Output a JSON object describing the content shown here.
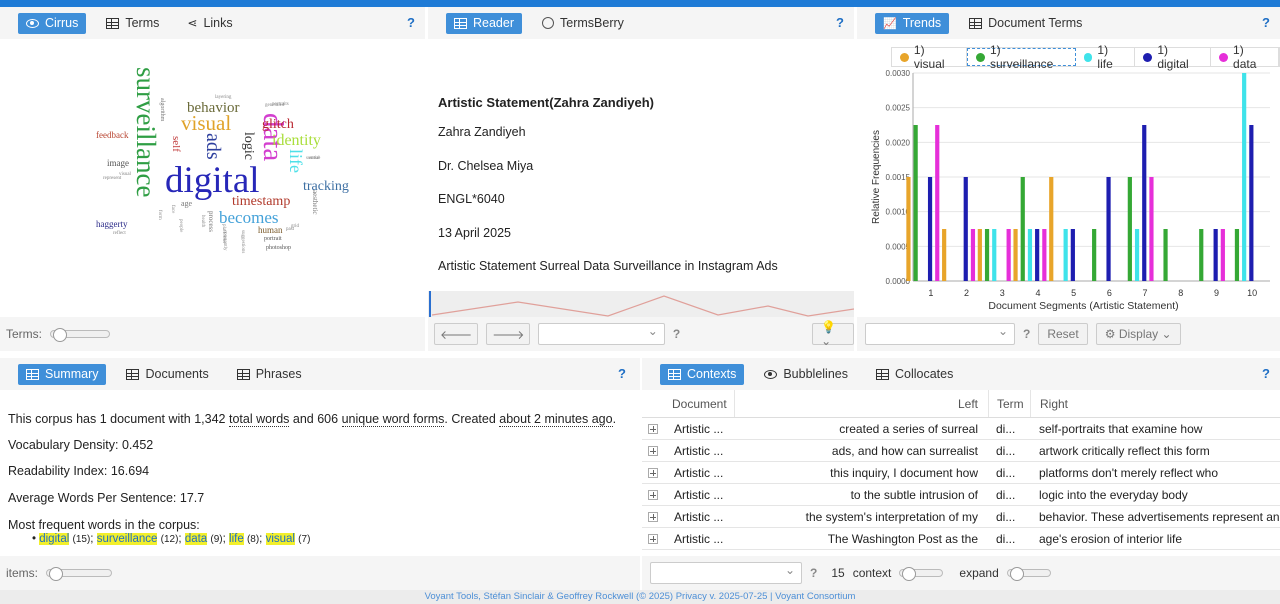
{
  "cirrus": {
    "tabs": [
      "Cirrus",
      "Terms",
      "Links"
    ],
    "help": "?",
    "footer_label": "Terms:",
    "words": [
      {
        "t": "surveillance",
        "size": 27,
        "color": "#2f9e44",
        "rot": 90
      },
      {
        "t": "digital",
        "size": 37,
        "color": "#2727b8",
        "rot": 0
      },
      {
        "t": "data",
        "size": 29,
        "color": "#d33fcf",
        "rot": 90
      },
      {
        "t": "visual",
        "size": 21,
        "color": "#e0a32a",
        "rot": 0
      },
      {
        "t": "ads",
        "size": 20,
        "color": "#2d3f9e",
        "rot": 90
      },
      {
        "t": "life",
        "size": 18,
        "color": "#4fe0e8",
        "rot": 90
      },
      {
        "t": "behavior",
        "size": 15,
        "color": "#6b6b3a",
        "rot": 0
      },
      {
        "t": "glitch",
        "size": 14,
        "color": "#b8252f",
        "rot": 0
      },
      {
        "t": "identity",
        "size": 16,
        "color": "#a9de3a",
        "rot": 0
      },
      {
        "t": "logic",
        "size": 14,
        "color": "#333",
        "rot": 90
      },
      {
        "t": "tracking",
        "size": 14,
        "color": "#3d6fa3",
        "rot": 0
      },
      {
        "t": "timestamp",
        "size": 14,
        "color": "#b13a2c",
        "rot": 0
      },
      {
        "t": "becomes",
        "size": 17,
        "color": "#45a2d9",
        "rot": 0
      },
      {
        "t": "self",
        "size": 11,
        "color": "#c03a3a",
        "rot": 90
      },
      {
        "t": "feedback",
        "size": 9,
        "color": "#b8432f",
        "rot": 0
      },
      {
        "t": "image",
        "size": 9,
        "color": "#555",
        "rot": 0
      },
      {
        "t": "haggerty",
        "size": 9,
        "color": "#2d2d8a",
        "rot": 0
      },
      {
        "t": "human",
        "size": 9,
        "color": "#7a5a2a",
        "rot": 0
      },
      {
        "t": "photoshop",
        "size": 6,
        "color": "#555",
        "rot": 0
      },
      {
        "t": "portrait",
        "size": 6,
        "color": "#555",
        "rot": 0
      },
      {
        "t": "aesthetic",
        "size": 7,
        "color": "#777",
        "rot": 90
      },
      {
        "t": "process",
        "size": 7,
        "color": "#777",
        "rot": 90
      },
      {
        "t": "age",
        "size": 8,
        "color": "#777",
        "rot": 0
      },
      {
        "t": "algorithm",
        "size": 6,
        "color": "#777",
        "rot": 90
      },
      {
        "t": "layering",
        "size": 5,
        "color": "#888",
        "rot": 0
      },
      {
        "t": "portraits",
        "size": 5,
        "color": "#888",
        "rot": 0
      },
      {
        "t": "generated",
        "size": 5,
        "color": "#888",
        "rot": 0
      },
      {
        "t": "surreal",
        "size": 5,
        "color": "#888",
        "rot": 0
      },
      {
        "t": "entire",
        "size": 5,
        "color": "#888",
        "rot": 0
      },
      {
        "t": "reflect",
        "size": 5,
        "color": "#888",
        "rot": 0
      },
      {
        "t": "represent",
        "size": 5,
        "color": "#888",
        "rot": 0
      },
      {
        "t": "visual",
        "size": 5,
        "color": "#888",
        "rot": 0
      },
      {
        "t": "face",
        "size": 5,
        "color": "#888",
        "rot": 90
      },
      {
        "t": "form",
        "size": 5,
        "color": "#888",
        "rot": 90
      },
      {
        "t": "health",
        "size": 5,
        "color": "#888",
        "rot": 90
      },
      {
        "t": "people",
        "size": 5,
        "color": "#888",
        "rot": 90
      },
      {
        "t": "suggestions",
        "size": 5,
        "color": "#888",
        "rot": 90
      },
      {
        "t": "platforms",
        "size": 5,
        "color": "#888",
        "rot": 90
      },
      {
        "t": "constantly",
        "size": 5,
        "color": "#888",
        "rot": 90
      },
      {
        "t": "grid",
        "size": 5,
        "color": "#888",
        "rot": 0
      },
      {
        "t": "past",
        "size": 5,
        "color": "#888",
        "rot": 0
      }
    ]
  },
  "reader": {
    "tabs": [
      "Reader",
      "TermsBerry"
    ],
    "help": "?",
    "title": "Artistic Statement(Zahra Zandiyeh)",
    "lines": [
      "Zahra Zandiyeh",
      "Dr. Chelsea Miya",
      "ENGL*6040",
      "13 April 2025",
      "Artistic Statement Surreal Data Surveillance in Instagram Ads"
    ],
    "footer_help": "?"
  },
  "trends": {
    "tabs": [
      "Trends",
      "Document Terms"
    ],
    "help": "?",
    "legend": [
      {
        "label": "1) visual",
        "color": "#e8a52a"
      },
      {
        "label": "1) surveillance",
        "color": "#35a835"
      },
      {
        "label": "1) life",
        "color": "#3fe3ea"
      },
      {
        "label": "1) digital",
        "color": "#1e1eb0"
      },
      {
        "label": "1) data",
        "color": "#e62fd9"
      }
    ],
    "footer": {
      "help": "?",
      "reset": "Reset",
      "display": "Display"
    }
  },
  "chart_data": {
    "type": "bar",
    "xlabel": "Document Segments (Artistic Statement)",
    "ylabel": "Relative Frequencies",
    "ylim": [
      0,
      0.003
    ],
    "yticks": [
      "0.0000",
      "0.0005",
      "0.0010",
      "0.0015",
      "0.0020",
      "0.0025",
      "0.0030"
    ],
    "categories": [
      "1",
      "2",
      "3",
      "4",
      "5",
      "6",
      "7",
      "8",
      "9",
      "10"
    ],
    "series": [
      {
        "name": "visual",
        "color": "#e8a52a",
        "values": [
          0.0015,
          0.00075,
          0.00075,
          0.00075,
          0.0015,
          0,
          0,
          0,
          0,
          0
        ]
      },
      {
        "name": "surveillance",
        "color": "#35a835",
        "values": [
          0.00225,
          0,
          0.00075,
          0.0015,
          0,
          0.00075,
          0.0015,
          0.00075,
          0.00075,
          0.00075
        ]
      },
      {
        "name": "life",
        "color": "#3fe3ea",
        "values": [
          0,
          0,
          0.00075,
          0.00075,
          0.00075,
          0,
          0.00075,
          0,
          0,
          0.003
        ]
      },
      {
        "name": "digital",
        "color": "#1e1eb0",
        "values": [
          0.0015,
          0.0015,
          0,
          0.00075,
          0.00075,
          0.0015,
          0.00225,
          0,
          0.00075,
          0.00225
        ]
      },
      {
        "name": "data",
        "color": "#e62fd9",
        "values": [
          0.00225,
          0.00075,
          0.00075,
          0.00075,
          0,
          0,
          0.0015,
          0,
          0.00075,
          0
        ]
      }
    ]
  },
  "summary": {
    "tabs": [
      "Summary",
      "Documents",
      "Phrases"
    ],
    "help": "?",
    "intro_a": "This corpus has 1 document with 1,342 ",
    "intro_total": "total words",
    "intro_b": " and 606 ",
    "intro_unique": "unique word forms",
    "intro_c": ". Created ",
    "intro_ago": "about 2 minutes ago",
    "intro_d": ".",
    "density_label": "Vocabulary Density:",
    "density_value": "0.452",
    "readability_label": "Readability Index:",
    "readability_value": "16.694",
    "avg_label": "Average Words Per Sentence:",
    "avg_value": "17.7",
    "frequent_label": "Most frequent words in the corpus:",
    "frequent": [
      {
        "word": "digital",
        "count": "(15)"
      },
      {
        "word": "surveillance",
        "count": "(12)"
      },
      {
        "word": "data",
        "count": "(9)"
      },
      {
        "word": "life",
        "count": "(8)"
      },
      {
        "word": "visual",
        "count": "(7)"
      }
    ],
    "footer_label": "items:"
  },
  "contexts": {
    "tabs": [
      "Contexts",
      "Bubblelines",
      "Collocates"
    ],
    "help": "?",
    "columns": [
      "Document",
      "Left",
      "Term",
      "Right"
    ],
    "rows": [
      {
        "doc": "Artistic ...",
        "left": "created a series of surreal",
        "term": "di...",
        "right": "self-portraits that examine how"
      },
      {
        "doc": "Artistic ...",
        "left": "ads, and how can surrealist",
        "term": "di...",
        "right": "artwork critically reflect this form"
      },
      {
        "doc": "Artistic ...",
        "left": "this inquiry, I document how",
        "term": "di...",
        "right": "platforms don't merely reflect who"
      },
      {
        "doc": "Artistic ...",
        "left": "to the subtle intrusion of",
        "term": "di...",
        "right": "logic into the everyday body"
      },
      {
        "doc": "Artistic ...",
        "left": "the system's interpretation of my",
        "term": "di...",
        "right": "behavior. These advertisements represent an"
      },
      {
        "doc": "Artistic ...",
        "left": "The Washington Post as the",
        "term": "di...",
        "right": "age's erosion of interior life"
      }
    ],
    "footer": {
      "help": "?",
      "context_value": "15",
      "context_label": "context",
      "expand_label": "expand"
    }
  },
  "credit": "Voyant Tools, Stéfan Sinclair & Geoffrey Rockwell (© 2025) Privacy v. 2025-07-25 | Voyant Consortium"
}
